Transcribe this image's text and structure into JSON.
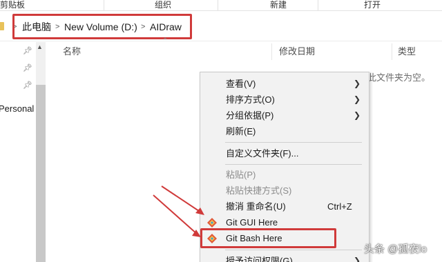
{
  "ribbon": {
    "groups": [
      "剪贴板",
      "组织",
      "新建",
      "打开"
    ]
  },
  "address": {
    "crumbs": [
      "此电脑",
      "New Volume (D:)",
      "AIDraw"
    ],
    "separator": ">"
  },
  "nav": {
    "item_personal": "Personal"
  },
  "list": {
    "col_name": "名称",
    "col_modified": "修改日期",
    "col_type": "类型",
    "empty_message": "此文件夹为空。"
  },
  "context_menu": {
    "view": "查看(V)",
    "sort_by": "排序方式(O)",
    "group_by": "分组依据(P)",
    "refresh": "刷新(E)",
    "customize_folder": "自定义文件夹(F)...",
    "paste": "粘贴(P)",
    "paste_shortcut": "粘贴快捷方式(S)",
    "undo_rename": "撤消 重命名(U)",
    "undo_shortcut": "Ctrl+Z",
    "git_gui": "Git GUI Here",
    "git_bash": "Git Bash Here",
    "grant_access": "授予访问权限(G)"
  },
  "icons": {
    "submenu": "chevron-right-icon",
    "git": "git-diamond-icon",
    "pin": "pin-icon"
  },
  "colors": {
    "highlight_box": "#d03a3a",
    "annotation_arrow": "#d03a3a",
    "menu_background": "#f2f2f2"
  },
  "watermark": "头条 @孤夜lo"
}
